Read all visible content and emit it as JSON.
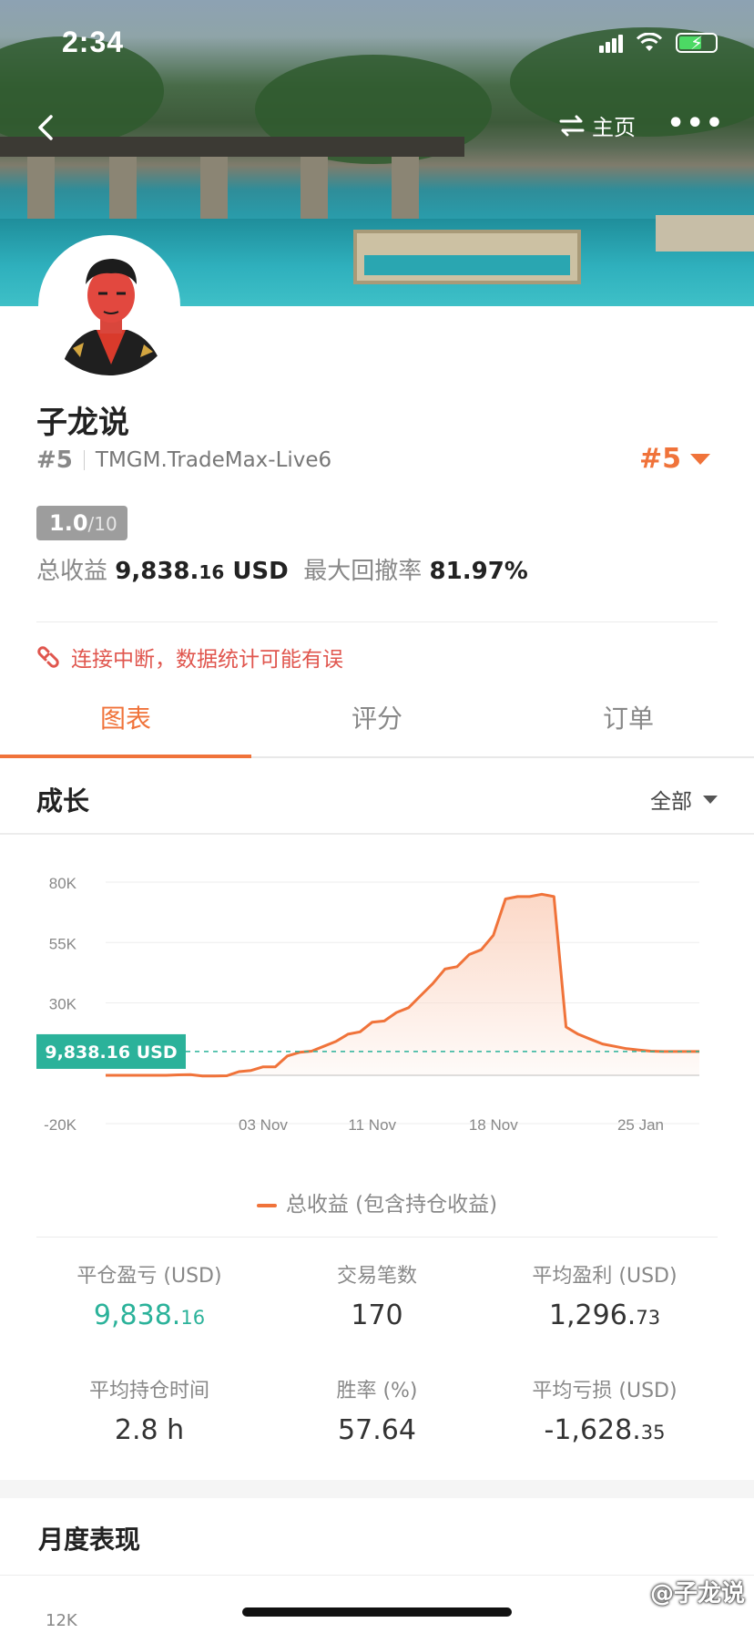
{
  "status": {
    "time": "2:34"
  },
  "nav": {
    "home_label": "主页",
    "more_label": "•••"
  },
  "profile": {
    "name": "子龙说",
    "rank": "#5",
    "account": "TMGM.TradeMax-Live6",
    "rank_right": "#5",
    "score": "1.0",
    "score_max": "/10",
    "total_profit_label": "总收益",
    "total_profit_int": "9,838.",
    "total_profit_dec": "16",
    "total_profit_ccy": "USD",
    "max_drawdown_label": "最大回撤率",
    "max_drawdown_value": "81.97%"
  },
  "alert": {
    "text": "连接中断，数据统计可能有误"
  },
  "tabs": [
    "图表",
    "评分",
    "订单"
  ],
  "section": {
    "title": "成长",
    "filter": "全部"
  },
  "chart_data": {
    "type": "area",
    "series": [
      {
        "name": "总收益 (包含持仓收益)",
        "x": [
          0,
          1,
          2,
          3,
          4,
          5,
          6,
          7,
          8,
          9,
          10,
          11,
          12,
          13,
          14,
          15,
          16,
          17,
          18,
          19,
          20,
          21,
          22,
          23,
          24,
          25,
          26,
          27,
          28,
          29,
          30,
          31,
          32,
          33,
          34,
          35,
          36,
          37,
          38,
          39,
          40,
          41,
          42,
          43,
          44,
          45,
          46,
          47,
          48,
          49
        ],
        "values": [
          0,
          0,
          0,
          0,
          0,
          0,
          200,
          300,
          -300,
          -300,
          -200,
          1500,
          2000,
          3500,
          3500,
          8000,
          9500,
          10000,
          12000,
          14000,
          17000,
          18000,
          22000,
          22500,
          26000,
          28000,
          33000,
          38000,
          44000,
          45000,
          50000,
          52000,
          58000,
          73000,
          74000,
          74000,
          75000,
          74000,
          20000,
          17000,
          15000,
          13000,
          12000,
          11000,
          10500,
          10000,
          9838,
          9838,
          9838,
          9838
        ]
      }
    ],
    "x_tick_labels": [
      "03 Nov",
      "11 Nov",
      "18 Nov",
      "25 Jan"
    ],
    "x_tick_positions": [
      13,
      22,
      32,
      44
    ],
    "y_ticks": [
      "80K",
      "55K",
      "30K",
      "-20K"
    ],
    "y_tick_values": [
      80000,
      55000,
      30000,
      -20000
    ],
    "ylim": [
      -20000,
      80000
    ],
    "current_value_label": "9,838.16 USD",
    "current_value": 9838.16,
    "baseline_value": 0,
    "colors": {
      "line": "#f0733a",
      "fill": "#fbd6c4",
      "marker": "#2bb29a"
    }
  },
  "legend": {
    "text": "总收益 (包含持仓收益)"
  },
  "stats": {
    "closed_pl": {
      "label": "平仓盈亏 (USD)",
      "int": "9,838.",
      "dec": "16"
    },
    "trades": {
      "label": "交易笔数",
      "value": "170"
    },
    "avg_profit": {
      "label": "平均盈利 (USD)",
      "int": "1,296.",
      "dec": "73"
    },
    "avg_hold": {
      "label": "平均持仓时间",
      "value": "2.8 h"
    },
    "win_rate": {
      "label": "胜率 (%)",
      "value": "57.64"
    },
    "avg_loss": {
      "label": "平均亏损 (USD)",
      "int": "-1,628.",
      "dec": "35"
    }
  },
  "monthly": {
    "title": "月度表现",
    "first_tick": "12K"
  },
  "watermark": "@子龙说"
}
